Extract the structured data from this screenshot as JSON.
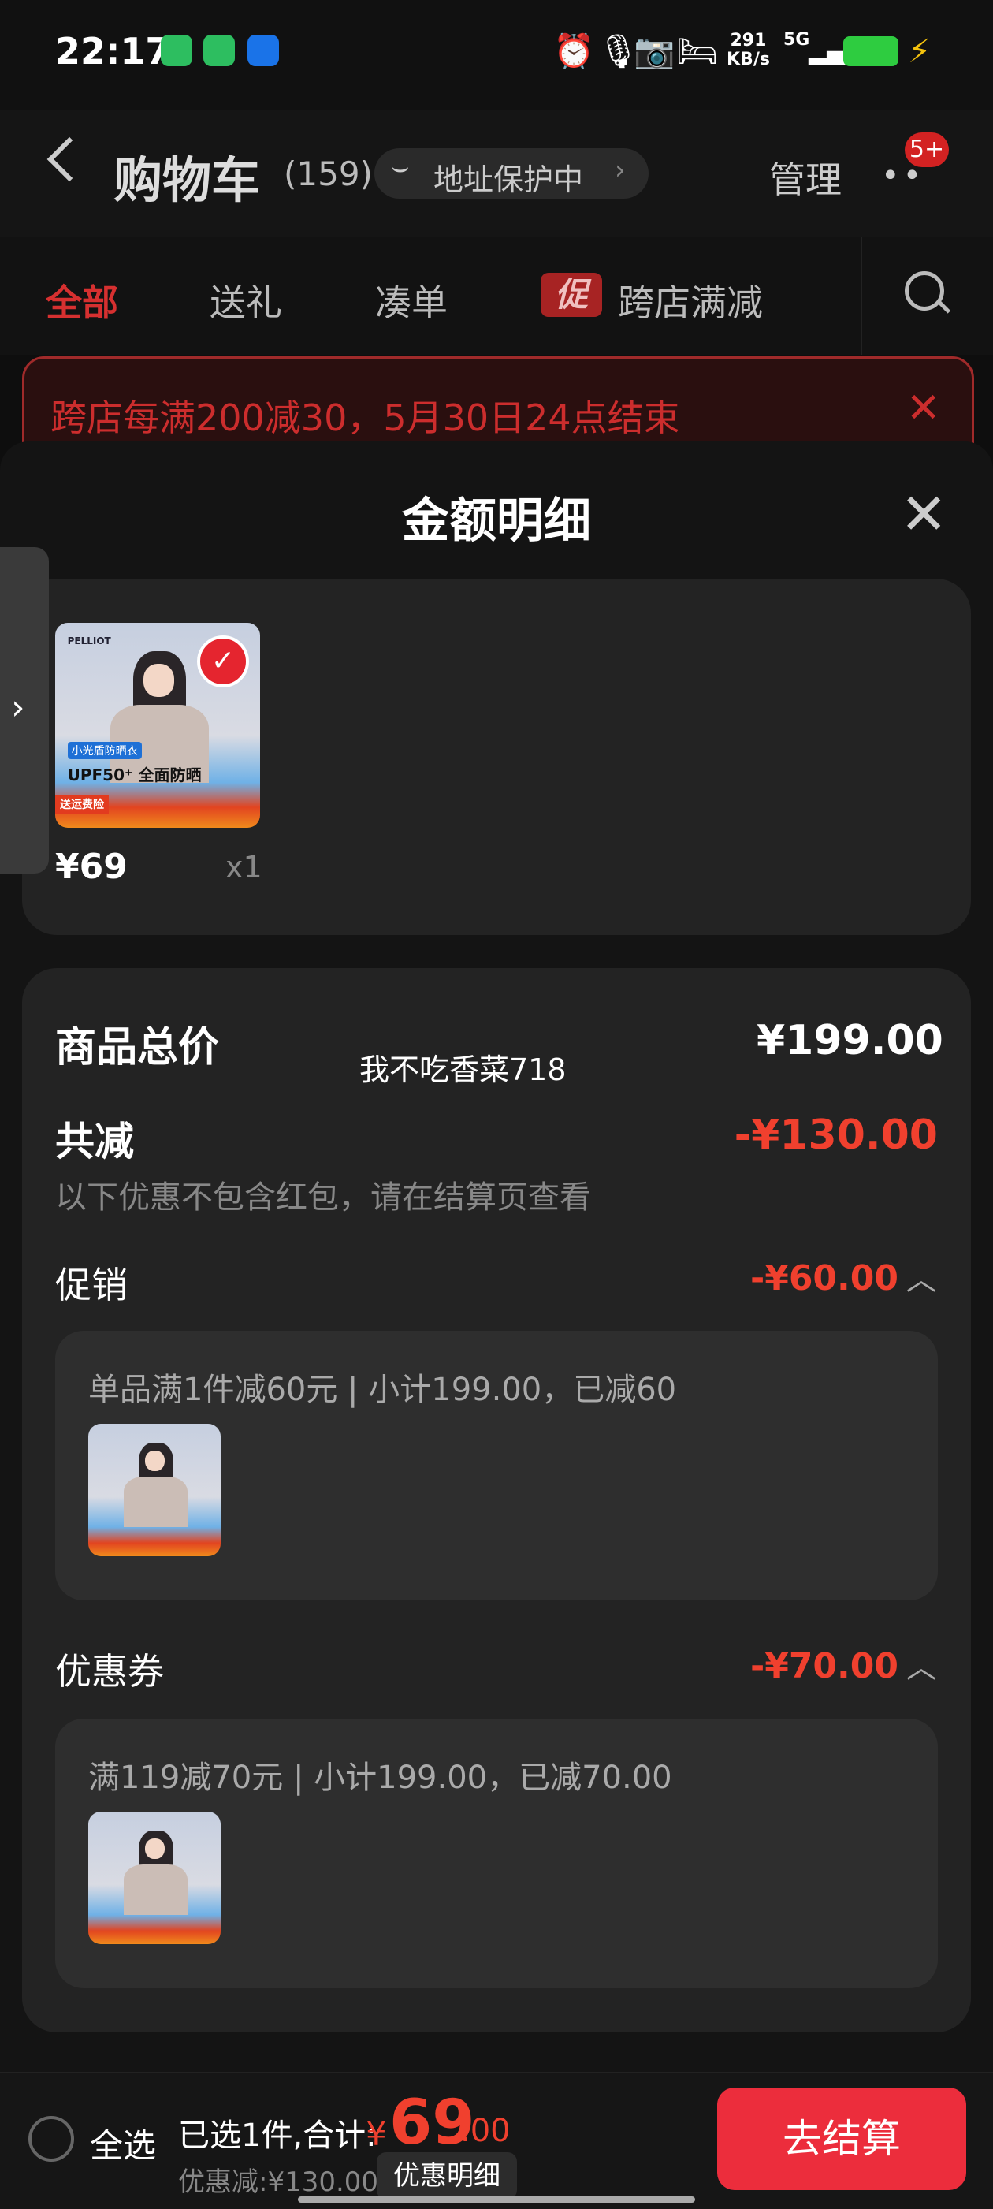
{
  "status_bar": {
    "time": "22:17",
    "net_speed_value": "291",
    "net_speed_unit": "KB/s",
    "network": "5G",
    "icons": [
      "wechat-icon",
      "wechat-icon",
      "broadcast-icon",
      "alarm-icon",
      "mic-icon",
      "camera-icon",
      "sleep-icon",
      "signal-icon",
      "battery-icon",
      "charging-icon"
    ]
  },
  "header": {
    "title": "购物车",
    "count": "(159)",
    "address_protection": "地址保护中",
    "manage": "管理",
    "more_badge": "5+"
  },
  "tabs": [
    {
      "label": "全部"
    },
    {
      "label": "送礼"
    },
    {
      "label": "凑单"
    },
    {
      "label": "跨店满减",
      "tag": "促"
    }
  ],
  "banner": {
    "text": "跨店每满200减30，5月30日24点结束"
  },
  "sheet": {
    "title": "金额明细",
    "product": {
      "price": "¥69",
      "quantity": "x1",
      "image": {
        "brand": "PELLIOT",
        "tag": "小光盾防晒衣",
        "headline": "UPF50⁺ 全面防晒",
        "insurance": "送运费险"
      }
    },
    "summary": {
      "total_label": "商品总价",
      "total_value": "¥199.00",
      "watermark": "我不吃香菜718",
      "reduce_label": "共减",
      "reduce_value": "-¥130.00",
      "reduce_note": "以下优惠不包含红包，请在结算页查看"
    },
    "promotion": {
      "label": "促销",
      "value": "-¥60.00",
      "desc": "单品满1件减60元 | 小计199.00，已减60"
    },
    "coupon": {
      "label": "优惠券",
      "value": "-¥70.00",
      "desc": "满119减70元 | 小计199.00，已减70.00"
    }
  },
  "bottom": {
    "select_all": "全选",
    "selected_text": "已选1件,合计:",
    "currency": "¥",
    "total_int": "69",
    "total_dec": ".00",
    "discount_text": "优惠减:¥130.00",
    "detail_button": "优惠明细",
    "checkout": "去结算"
  },
  "colors": {
    "accent_red": "#f0402e",
    "checkout_red": "#ec2d3c",
    "background": "#0e0e0e",
    "card": "#232323"
  }
}
